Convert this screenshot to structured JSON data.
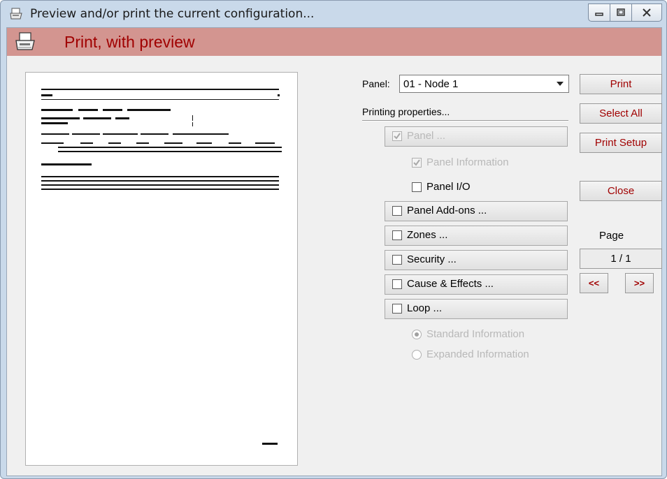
{
  "window": {
    "title": "Preview and/or print the current configuration...",
    "buttons": [
      "minimize-icon",
      "maximize-icon",
      "close-icon"
    ]
  },
  "header": {
    "title": "Print, with preview",
    "icon": "printer-icon"
  },
  "panel_select": {
    "label": "Panel:",
    "value": "01 - Node 1"
  },
  "printing_properties": {
    "label": "Printing properties...",
    "options": [
      {
        "label": "Panel ...",
        "checked": true,
        "enabled": false
      },
      {
        "label": "Panel Information",
        "checked": true,
        "enabled": false
      },
      {
        "label": "Panel I/O",
        "checked": false,
        "enabled": true
      },
      {
        "label": "Panel Add-ons ...",
        "checked": false,
        "enabled": true
      },
      {
        "label": "Zones ...",
        "checked": false,
        "enabled": true
      },
      {
        "label": "Security ...",
        "checked": false,
        "enabled": true
      },
      {
        "label": "Cause & Effects ...",
        "checked": false,
        "enabled": true
      },
      {
        "label": "Loop ...",
        "checked": false,
        "enabled": true
      }
    ],
    "radios": [
      {
        "label": "Standard Information",
        "selected": true,
        "enabled": false
      },
      {
        "label": "Expanded Information",
        "selected": false,
        "enabled": false
      }
    ]
  },
  "actions": {
    "print": "Print",
    "select_all": "Select All",
    "print_setup": "Print Setup",
    "close": "Close"
  },
  "pagination": {
    "label": "Page",
    "value": "1 / 1",
    "prev": "<<",
    "next": ">>"
  },
  "preview": {
    "footer": "Page 1"
  },
  "colors": {
    "header_bg": "#d39590",
    "accent_text": "#a00000",
    "window_frame": "#c9d9ea"
  }
}
